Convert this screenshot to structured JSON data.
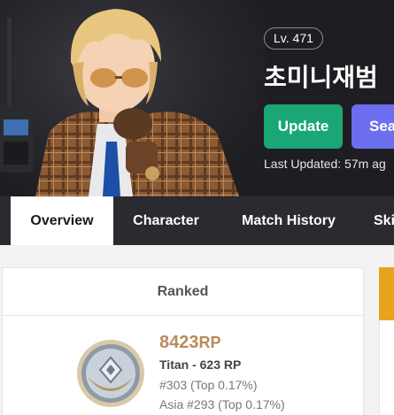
{
  "profile": {
    "level": "Lv. 471",
    "name": "초미니재범",
    "last_updated": "Last Updated: 57m ag"
  },
  "actions": {
    "update_label": "Update",
    "search_label": "Sea"
  },
  "tabs": [
    {
      "label": "Overview",
      "active": true
    },
    {
      "label": "Character",
      "active": false
    },
    {
      "label": "Match History",
      "active": false
    },
    {
      "label": "Ski",
      "active": false
    }
  ],
  "ranked": {
    "title": "Ranked",
    "rp_value": "8423",
    "rp_unit": "RP",
    "tier": "Titan - 623 RP",
    "global_rank": "#303 (Top 0.17%)",
    "region_rank": "Asia #293 (Top 0.17%)"
  },
  "colors": {
    "update": "#1aa775",
    "search": "#6c6ef0",
    "rp": "#b88b5c",
    "accent": "#e8a31c"
  }
}
